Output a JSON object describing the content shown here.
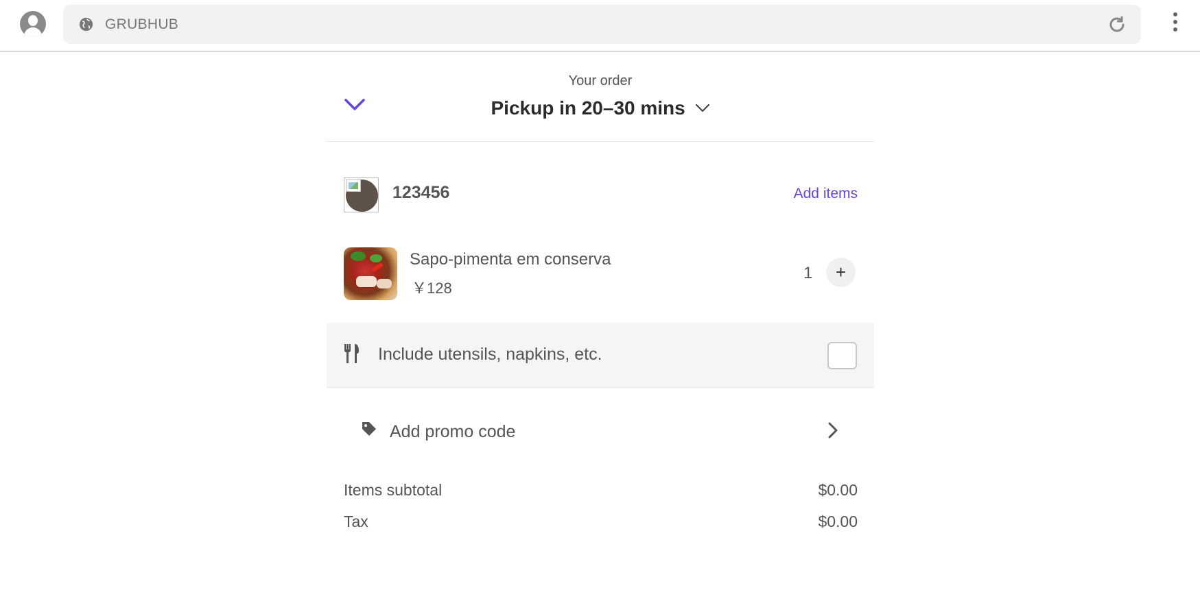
{
  "browser": {
    "url_text": "GRUBHUB",
    "icons": [
      "avatar-icon",
      "globe-icon",
      "reload-icon",
      "more-options-icon"
    ]
  },
  "header": {
    "subtitle": "Your order",
    "pickup_label": "Pickup in 20–30 mins"
  },
  "store": {
    "name": "123456",
    "add_items_label": "Add items"
  },
  "items": [
    {
      "name": "Sapo-pimenta em conserva",
      "price": "￥128",
      "quantity": "1",
      "plus_label": "+"
    }
  ],
  "utensils": {
    "label": "Include utensils, napkins, etc.",
    "checked": false
  },
  "promo": {
    "label": "Add promo code"
  },
  "totals": [
    {
      "label": "Items subtotal",
      "value": "$0.00"
    },
    {
      "label": "Tax",
      "value": "$0.00"
    }
  ],
  "colors": {
    "accent": "#6244ee",
    "text": "#555555",
    "panel_gray": "#f5f5f5"
  }
}
